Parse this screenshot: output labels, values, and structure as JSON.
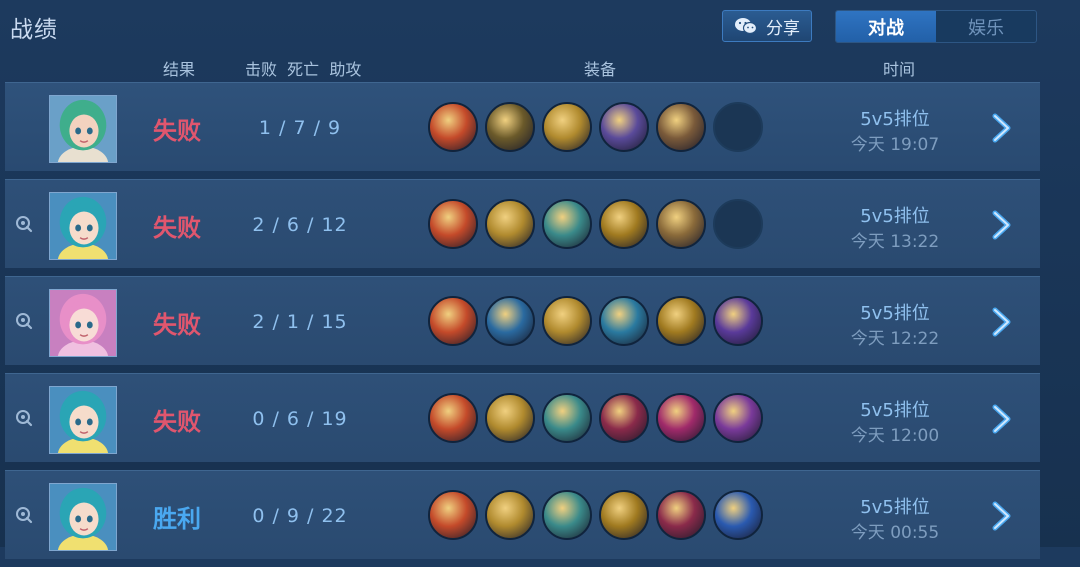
{
  "header": {
    "title": "战绩",
    "share_label": "分享",
    "tabs": [
      {
        "label": "对战",
        "active": true
      },
      {
        "label": "娱乐",
        "active": false
      }
    ]
  },
  "columns": {
    "result": "结果",
    "kda": "击败  死亡  助攻",
    "equipment": "装备",
    "time": "时间"
  },
  "colors": {
    "lose": "#e0566e",
    "win": "#4aa8f0",
    "accent": "#2f74c2"
  },
  "matches": [
    {
      "result": "失败",
      "outcome": "lose",
      "kda": "1 / 7 / 9",
      "mode": "5v5排位",
      "time": "今天 19:07",
      "replay": false,
      "avatar": "hero-green-hair",
      "items": [
        "#c44a2a",
        "#6b5a2a",
        "#b08a2e",
        "#5a4a9a",
        "#7a5a3a",
        "empty"
      ]
    },
    {
      "result": "失败",
      "outcome": "lose",
      "kda": "2 / 6 / 12",
      "mode": "5v5排位",
      "time": "今天 13:22",
      "replay": true,
      "avatar": "hero-teal-hair",
      "items": [
        "#c44a2a",
        "#b08a2e",
        "#3a8a8a",
        "#a07a20",
        "#8a6a3a",
        "empty"
      ]
    },
    {
      "result": "失败",
      "outcome": "lose",
      "kda": "2 / 1 / 15",
      "mode": "5v5排位",
      "time": "今天 12:22",
      "replay": true,
      "avatar": "hero-pink-hair",
      "items": [
        "#c44a2a",
        "#2a6aa0",
        "#b08a2e",
        "#2a7aa0",
        "#a07a20",
        "#5a3a9a"
      ]
    },
    {
      "result": "失败",
      "outcome": "lose",
      "kda": "0 / 6 / 19",
      "mode": "5v5排位",
      "time": "今天 12:00",
      "replay": true,
      "avatar": "hero-teal-hair",
      "items": [
        "#c44a2a",
        "#b08a2e",
        "#3a8a8a",
        "#8a2a4a",
        "#a02a6a",
        "#7a3a9a"
      ]
    },
    {
      "result": "胜利",
      "outcome": "win",
      "kda": "0 / 9 / 22",
      "mode": "5v5排位",
      "time": "今天 00:55",
      "replay": true,
      "avatar": "hero-teal-hair",
      "items": [
        "#c44a2a",
        "#b08a2e",
        "#3a8a8a",
        "#a07a20",
        "#8a2a4a",
        "#2a5ab0"
      ]
    }
  ]
}
